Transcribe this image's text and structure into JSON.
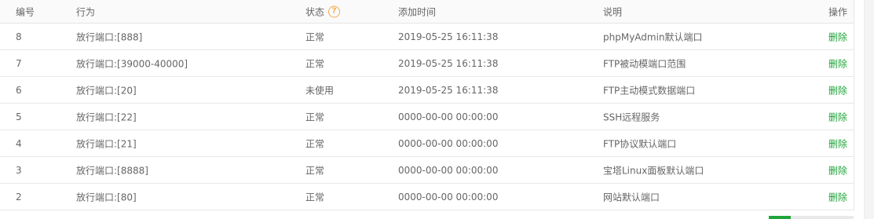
{
  "header": {
    "id": "编号",
    "action": "行为",
    "status": "状态",
    "time": "添加时间",
    "desc": "说明",
    "op": "操作",
    "help_glyph": "?"
  },
  "rows": [
    {
      "id": "8",
      "action": "放行端口:[888]",
      "status": "正常",
      "time": "2019-05-25 16:11:38",
      "desc": "phpMyAdmin默认端口",
      "op": "删除"
    },
    {
      "id": "7",
      "action": "放行端口:[39000-40000]",
      "status": "正常",
      "time": "2019-05-25 16:11:38",
      "desc": "FTP被动模端口范围",
      "op": "删除"
    },
    {
      "id": "6",
      "action": "放行端口:[20]",
      "status": "未使用",
      "time": "2019-05-25 16:11:38",
      "desc": "FTP主动模式数据端口",
      "op": "删除"
    },
    {
      "id": "5",
      "action": "放行端口:[22]",
      "status": "正常",
      "time": "0000-00-00 00:00:00",
      "desc": "SSH远程服务",
      "op": "删除"
    },
    {
      "id": "4",
      "action": "放行端口:[21]",
      "status": "正常",
      "time": "0000-00-00 00:00:00",
      "desc": "FTP协议默认端口",
      "op": "删除"
    },
    {
      "id": "3",
      "action": "放行端口:[8888]",
      "status": "正常",
      "time": "0000-00-00 00:00:00",
      "desc": "宝塔Linux面板默认端口",
      "op": "删除"
    },
    {
      "id": "2",
      "action": "放行端口:[80]",
      "status": "正常",
      "time": "0000-00-00 00:00:00",
      "desc": "网站默认端口",
      "op": "删除"
    }
  ],
  "colors": {
    "delete_link": "#20a53a",
    "help_icon": "#f0ad4e"
  }
}
